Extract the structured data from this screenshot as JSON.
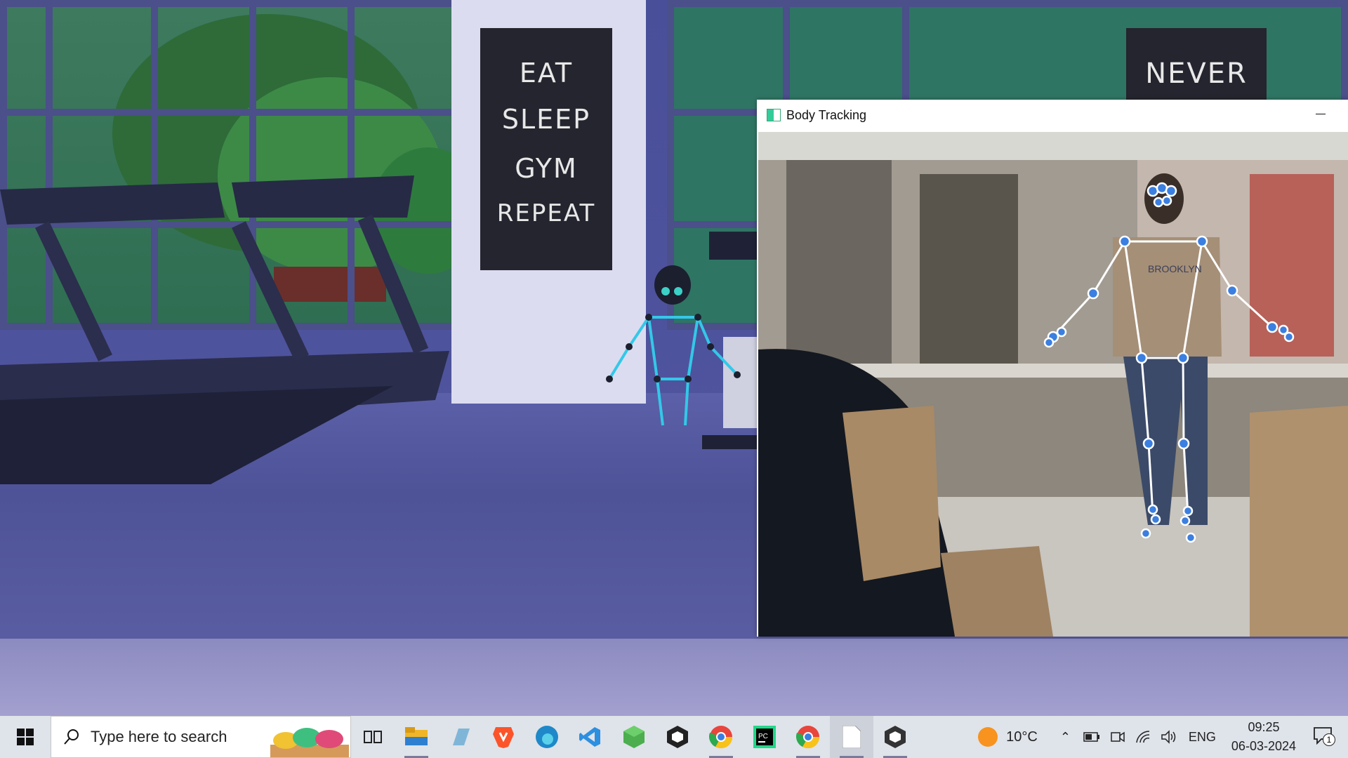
{
  "scene": {
    "poster_lines": [
      "EAT",
      "SLEEP",
      "GYM",
      "REPEAT"
    ],
    "poster2_text": "NEVER"
  },
  "body_tracking_window": {
    "title": "Body Tracking",
    "shirt_text": "BROOKLYN"
  },
  "taskbar": {
    "search_placeholder": "Type here to search",
    "pinned_apps": [
      "task-view",
      "file-explorer",
      "notes-app",
      "brave-browser",
      "edge-browser",
      "vscode",
      "green-hex-app",
      "unity-hub",
      "chrome-profile-1",
      "pycharm",
      "chrome-profile-2",
      "notepad",
      "unity-editor"
    ],
    "weather_temp": "10°C",
    "language": "ENG",
    "time": "09:25",
    "date": "06-03-2024",
    "notification_count": "1"
  },
  "colors": {
    "skeleton_blue": "#3b7fe0",
    "stick_figure_cyan": "#33c8e8",
    "taskbar_bg": "#dfe3ea"
  }
}
